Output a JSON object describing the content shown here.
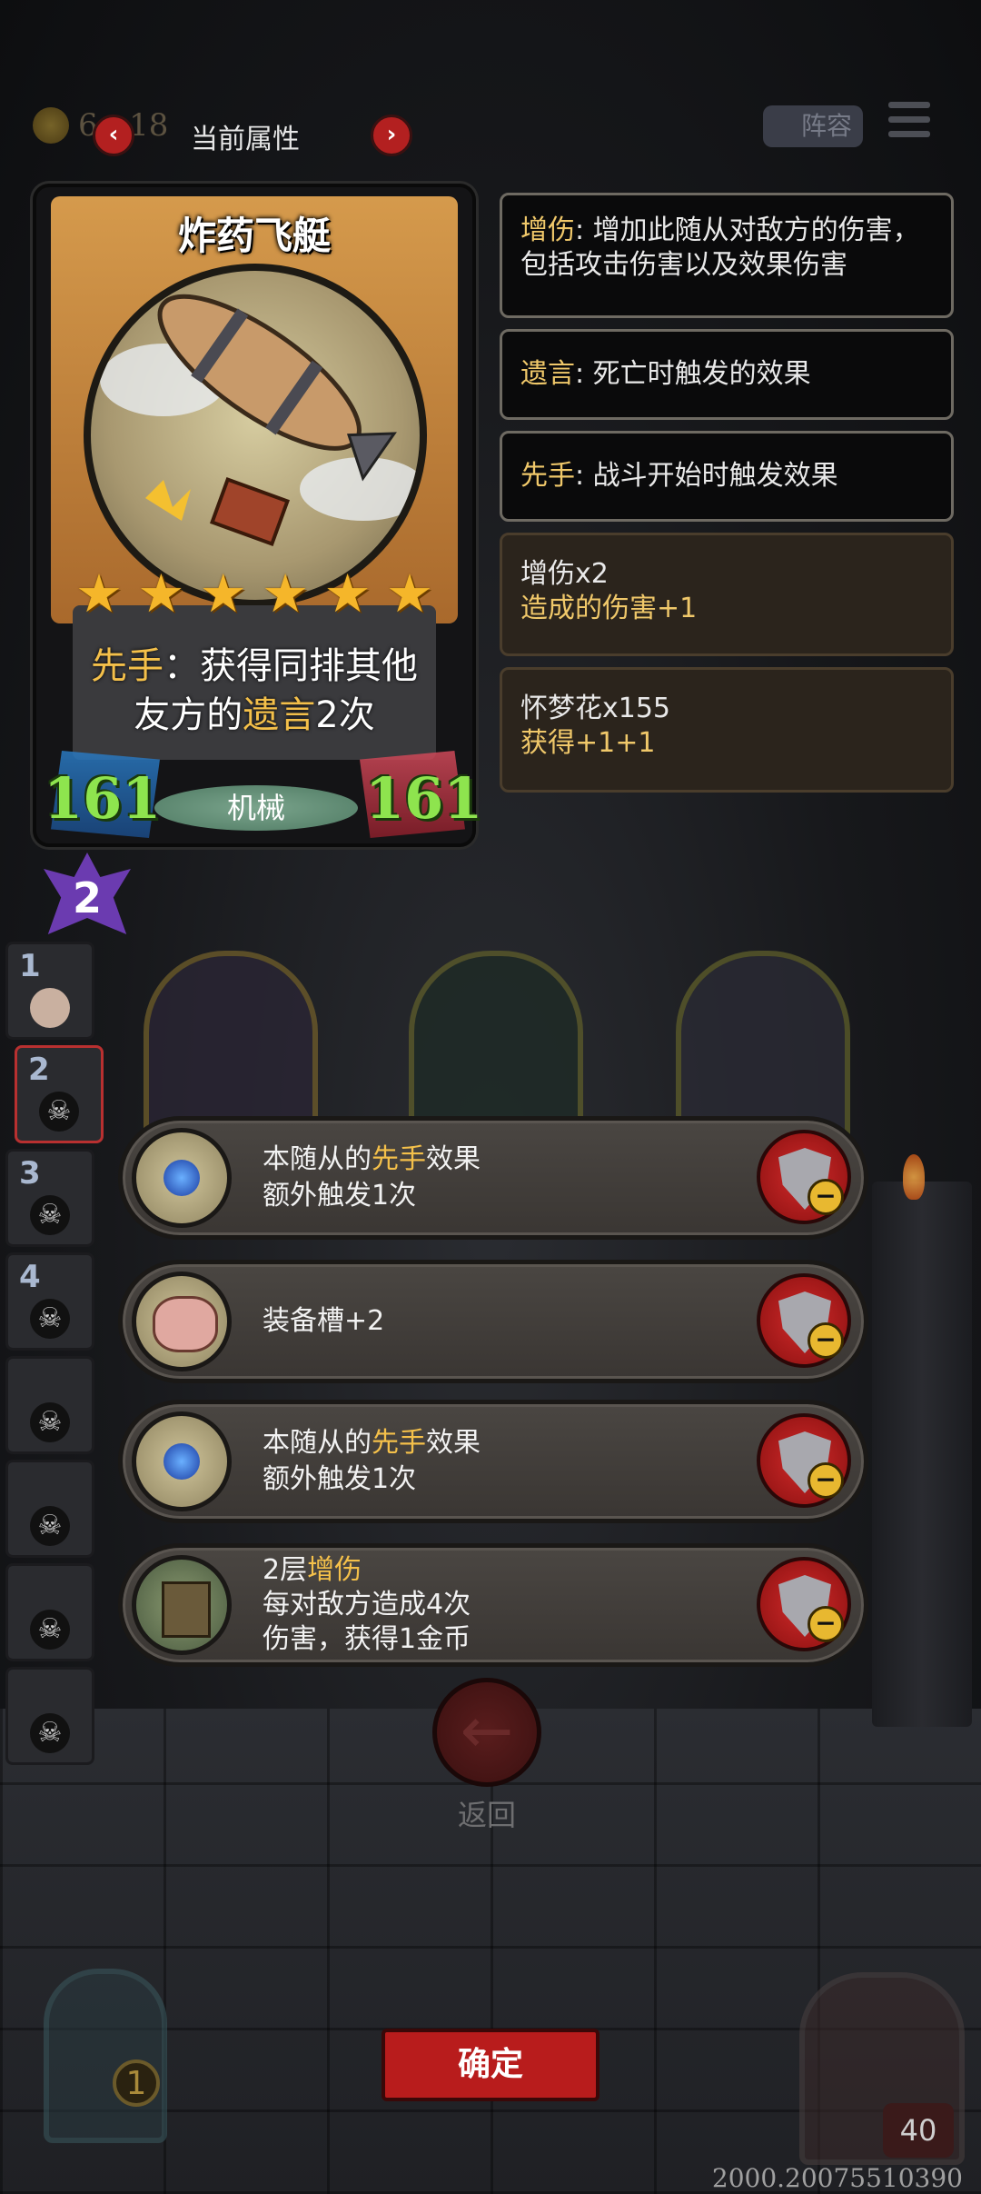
{
  "top_bar": {
    "coins": "6",
    "coin_bonus": "+18",
    "title": "当前属性",
    "prev_icon": "‹",
    "next_icon": "›",
    "lineup_label": "阵容"
  },
  "card": {
    "name": "炸药飞艇",
    "stars": 6,
    "ability": {
      "kw1": "先手",
      "sep": "：",
      "text1": "获得同排其他",
      "text2": "友方的",
      "kw2": "遗言",
      "text3": "2次"
    },
    "attack": "161",
    "health": "161",
    "tribe": "机械",
    "tier": "2"
  },
  "keywords": [
    {
      "name": "增伤",
      "colon": ": ",
      "desc": "增加此随从对敌方的伤害，包括攻击伤害以及效果伤害"
    },
    {
      "name": "遗言",
      "colon": ": ",
      "desc": "死亡时触发的效果"
    },
    {
      "name": "先手",
      "colon": ": ",
      "desc": "战斗开始时触发效果"
    }
  ],
  "buffs": [
    {
      "title": "增伤x2",
      "detail": "造成的伤害+1"
    },
    {
      "title": "怀梦花x155",
      "detail": "获得+1+1"
    }
  ],
  "lineup": {
    "slots": [
      "1",
      "2",
      "3",
      "4",
      "",
      "",
      "",
      ""
    ],
    "selected": 2
  },
  "equipment": [
    {
      "icon": "blue-orb-icon",
      "pre": "本随从的",
      "kw": "先手",
      "post": "效果",
      "line2": "额外触发1次",
      "line3": ""
    },
    {
      "icon": "pig-icon",
      "pre": "装备槽+2",
      "kw": "",
      "post": "",
      "line2": "",
      "line3": ""
    },
    {
      "icon": "blue-orb-icon",
      "pre": "本随从的",
      "kw": "先手",
      "post": "效果",
      "line2": "额外触发1次",
      "line3": ""
    },
    {
      "icon": "machine-icon",
      "pre": "2层",
      "kw": "增伤",
      "post": "",
      "line2": "每对敌方造成4次",
      "line3": "伤害，获得1金币"
    }
  ],
  "back_label": "返回",
  "back_icon": "←",
  "confirm_label": "确定",
  "hero_left_badge": "1",
  "hero_right_hp": "40",
  "version": "2000.20075510390",
  "colors": {
    "keyword": "#f4c04a",
    "remove_button": "#c81f1f",
    "confirm": "#b81c1c",
    "attack": "#8ee44e"
  }
}
